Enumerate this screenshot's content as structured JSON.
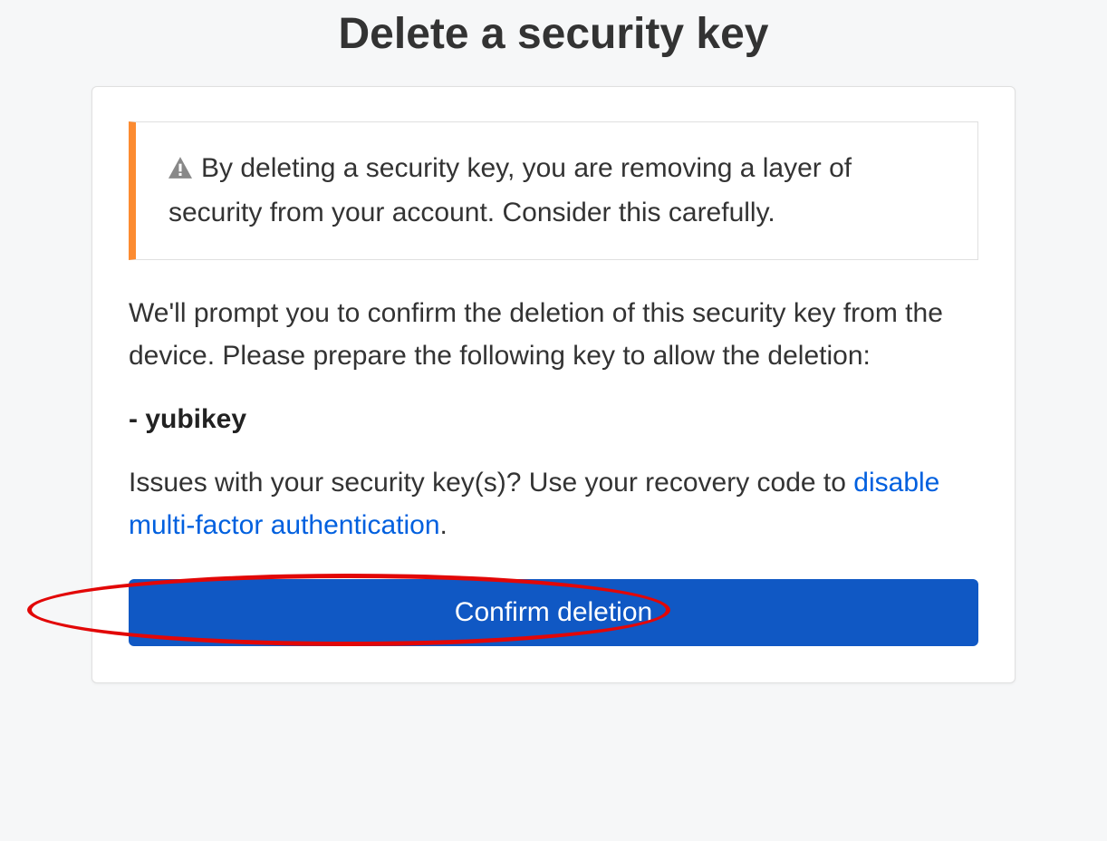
{
  "title": "Delete a security key",
  "warning": {
    "text": "By deleting a security key, you are removing a layer of security from your account. Consider this carefully."
  },
  "prompt_text": "We'll prompt you to confirm the deletion of this security key from the device. Please prepare the following key to allow the deletion:",
  "key_prefix": "- ",
  "key_name": "yubikey",
  "issues_text_before": "Issues with your security key(s)? Use your recovery code to ",
  "disable_link_text": "disable multi-factor authentication",
  "issues_text_after": ".",
  "confirm_button_label": "Confirm deletion"
}
